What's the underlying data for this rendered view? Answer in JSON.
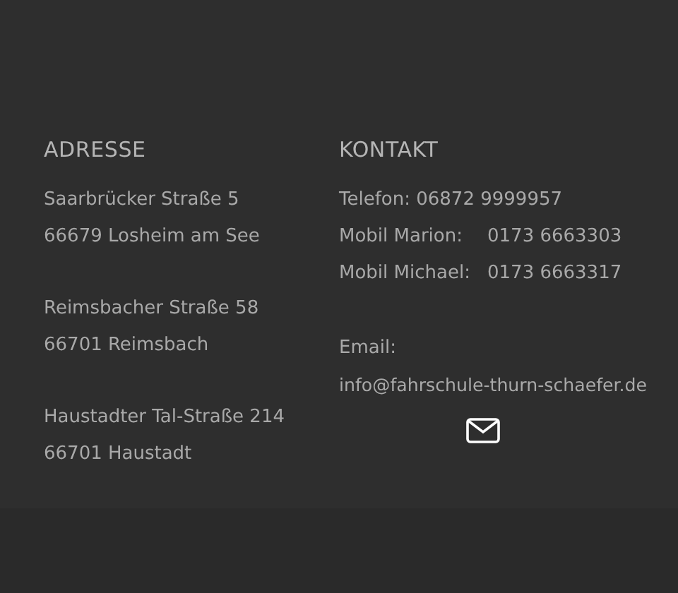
{
  "address": {
    "heading": "ADRESSE",
    "blocks": [
      {
        "lines": [
          "Saarbrücker Straße 5",
          "66679 Losheim am See"
        ]
      },
      {
        "lines": [
          "Reimsbacher Straße 58",
          "66701 Reimsbach"
        ]
      },
      {
        "lines": [
          "Haustadter Tal-Straße 214",
          "66701 Haustadt"
        ]
      }
    ]
  },
  "contact": {
    "heading": "KONTAKT",
    "phone": "Telefon: 06872 9999957",
    "mobiles": [
      {
        "label": "Mobil Marion:",
        "number": "0173 6663303"
      },
      {
        "label": "Mobil Michael:",
        "number": "0173 6663317"
      }
    ],
    "email_label": "Email:",
    "email": "info@fahrschule-thurn-schaefer.de"
  }
}
